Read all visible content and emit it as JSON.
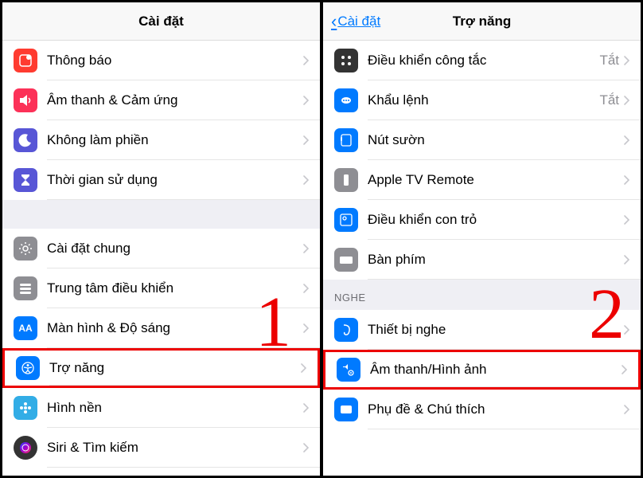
{
  "left": {
    "title": "Cài đặt",
    "big_number": "1",
    "groups": [
      {
        "items": [
          {
            "name": "notifications",
            "label": "Thông báo",
            "icon": "notifications",
            "color": "c-red"
          },
          {
            "name": "sounds",
            "label": "Âm thanh & Cảm ứng",
            "icon": "speaker",
            "color": "c-red2"
          },
          {
            "name": "dnd",
            "label": "Không làm phiền",
            "icon": "moon",
            "color": "c-purple"
          },
          {
            "name": "screentime",
            "label": "Thời gian sử dụng",
            "icon": "hourglass",
            "color": "c-purple"
          }
        ]
      },
      {
        "items": [
          {
            "name": "general",
            "label": "Cài đặt chung",
            "icon": "gear",
            "color": "c-grey"
          },
          {
            "name": "control-center",
            "label": "Trung tâm điều khiển",
            "icon": "sliders",
            "color": "c-grey"
          },
          {
            "name": "display",
            "label": "Màn hình & Độ sáng",
            "icon": "aa",
            "color": "c-blueA"
          },
          {
            "name": "accessibility",
            "label": "Trợ năng",
            "icon": "accessibility",
            "color": "c-blueA",
            "highlight": true
          },
          {
            "name": "wallpaper",
            "label": "Hình nền",
            "icon": "flower",
            "color": "c-cyan"
          },
          {
            "name": "siri",
            "label": "Siri & Tìm kiếm",
            "icon": "siri",
            "color": "c-dark",
            "circ": true
          }
        ]
      }
    ]
  },
  "right": {
    "title": "Trợ năng",
    "back_label": "Cài đặt",
    "big_number": "2",
    "groups": [
      {
        "items": [
          {
            "name": "switch-control",
            "label": "Điều khiển công tắc",
            "icon": "grid",
            "color": "c-dark",
            "value": "Tắt"
          },
          {
            "name": "voice-control",
            "label": "Khẩu lệnh",
            "icon": "voice",
            "color": "c-blueA",
            "value": "Tắt"
          },
          {
            "name": "side-button",
            "label": "Nút sườn",
            "icon": "button",
            "color": "c-blueA"
          },
          {
            "name": "apple-tv",
            "label": "Apple TV Remote",
            "icon": "remote",
            "color": "c-grey"
          },
          {
            "name": "pointer",
            "label": "Điều khiển con trỏ",
            "icon": "pointer",
            "color": "c-blueA"
          },
          {
            "name": "keyboard",
            "label": "Bàn phím",
            "icon": "keyboard",
            "color": "c-grey"
          }
        ]
      },
      {
        "header": "NGHE",
        "items": [
          {
            "name": "hearing",
            "label": "Thiết bị nghe",
            "icon": "ear",
            "color": "c-blueA"
          },
          {
            "name": "audio-visual",
            "label": "Âm thanh/Hình ảnh",
            "icon": "av",
            "color": "c-blueA",
            "highlight": true
          },
          {
            "name": "subtitles",
            "label": "Phụ đề & Chú thích",
            "icon": "cc",
            "color": "c-blueA"
          }
        ]
      }
    ]
  }
}
